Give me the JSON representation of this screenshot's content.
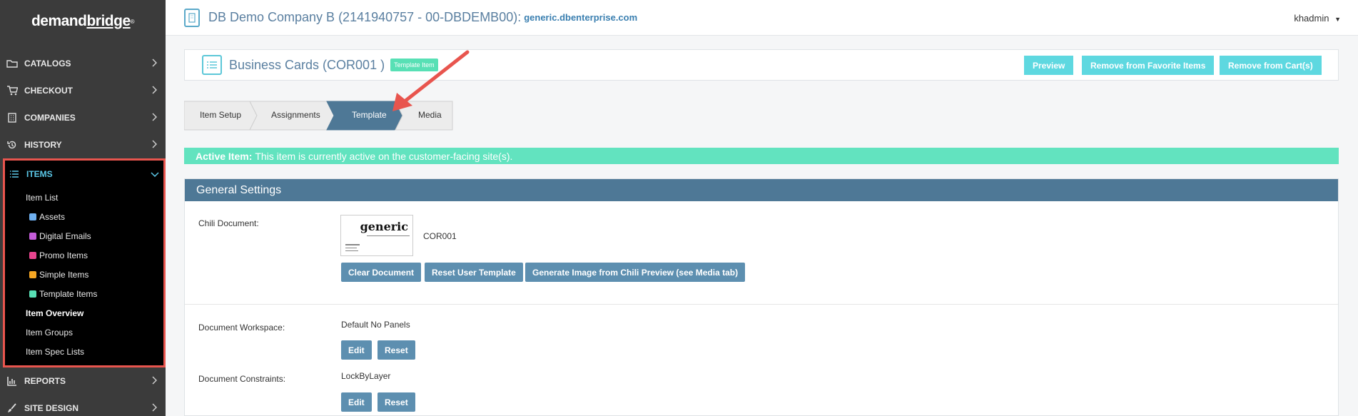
{
  "app": {
    "logo_main": "demand",
    "logo_accent": "bridge"
  },
  "sidebar": {
    "items": [
      {
        "label": "CATALOGS",
        "icon": "folder-icon"
      },
      {
        "label": "CHECKOUT",
        "icon": "cart-icon"
      },
      {
        "label": "COMPANIES",
        "icon": "building-icon"
      },
      {
        "label": "HISTORY",
        "icon": "history-icon"
      },
      {
        "label": "ITEMS",
        "icon": "list-icon"
      },
      {
        "label": "REPORTS",
        "icon": "bar-chart-icon"
      },
      {
        "label": "SITE DESIGN",
        "icon": "brush-icon"
      }
    ],
    "items_sub": [
      {
        "label": "Item List"
      },
      {
        "label": "Assets",
        "color": "#6fb0f0"
      },
      {
        "label": "Digital Emails",
        "color": "#c45cd8"
      },
      {
        "label": "Promo Items",
        "color": "#e8458f"
      },
      {
        "label": "Simple Items",
        "color": "#f5a623"
      },
      {
        "label": "Template Items",
        "color": "#58e0b5"
      },
      {
        "label": "Item Overview"
      },
      {
        "label": "Item Groups"
      },
      {
        "label": "Item Spec Lists"
      }
    ]
  },
  "topbar": {
    "company": "DB Demo Company B (2141940757 - 00-DBDEMB00):",
    "url": "generic.dbenterprise.com",
    "user": "khadmin"
  },
  "item": {
    "title": "Business Cards (COR001 )",
    "badge": "Template Item",
    "buttons": {
      "preview": "Preview",
      "remove_favorite": "Remove from Favorite Items",
      "remove_cart": "Remove from Cart(s)"
    }
  },
  "steps": [
    "Item Setup",
    "Assignments",
    "Template",
    "Media"
  ],
  "notice": {
    "strong": "Active Item:",
    "text": "This item is currently active on the customer-facing site(s)."
  },
  "panel": {
    "title": "General Settings",
    "chili_label": "Chili Document:",
    "chili_value": "COR001",
    "thumb_brand": "generic",
    "btn_clear": "Clear Document",
    "btn_reset_user": "Reset User Template",
    "btn_generate": "Generate Image from Chili Preview (see Media tab)",
    "workspace_label": "Document Workspace:",
    "workspace_value": "Default No Panels",
    "constraints_label": "Document Constraints:",
    "constraints_value": "LockByLayer",
    "btn_edit": "Edit",
    "btn_reset": "Reset"
  },
  "colors": {
    "sidebar_bg": "#3b3b3b",
    "highlight_border": "#e8554e",
    "accent_teal": "#5ed8e0",
    "panel_head": "#4e7896",
    "active_step": "#4e7896",
    "notice_bg": "#62e3bf"
  }
}
